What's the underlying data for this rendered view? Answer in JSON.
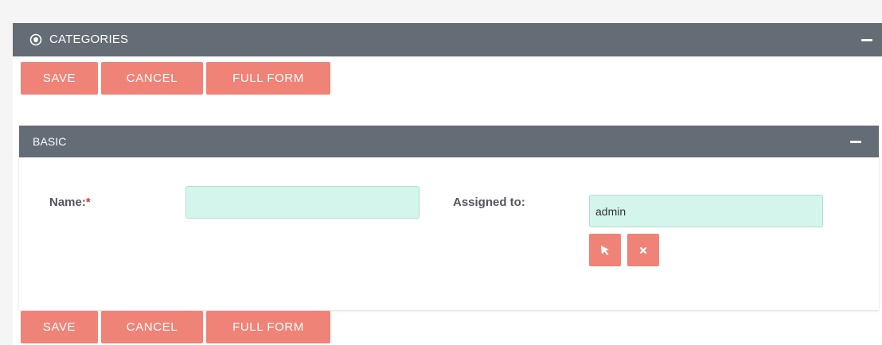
{
  "module": {
    "title": "CATEGORIES",
    "icon": "categories-icon",
    "collapse_icon": "minus-icon"
  },
  "buttons": {
    "save": "SAVE",
    "cancel": "CANCEL",
    "full_form": "FULL FORM"
  },
  "panel": {
    "title": "BASIC",
    "collapse_icon": "minus-icon"
  },
  "fields": {
    "name": {
      "label": "Name:",
      "required_marker": "*",
      "value": ""
    },
    "assigned_to": {
      "label": "Assigned to:",
      "value": "admin",
      "select_icon": "cursor-arrow-icon",
      "clear_icon": "close-icon"
    }
  },
  "colors": {
    "header_bg": "#646c75",
    "button_bg": "#f08377",
    "input_bg": "#d4f5ec",
    "required": "#d9342b"
  }
}
